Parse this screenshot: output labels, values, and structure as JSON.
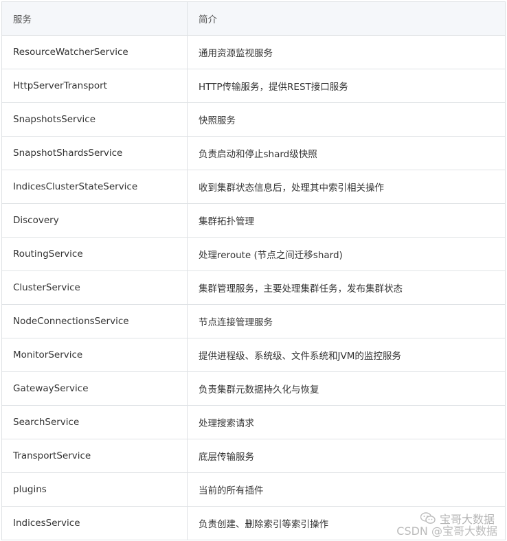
{
  "table": {
    "headers": [
      "服务",
      "简介"
    ],
    "rows": [
      [
        "ResourceWatcherService",
        "通用资源监视服务"
      ],
      [
        "HttpServerTransport",
        "HTTP传输服务，提供REST接口服务"
      ],
      [
        "SnapshotsService",
        "快照服务"
      ],
      [
        "SnapshotShardsService",
        "负责启动和停止shard级快照"
      ],
      [
        "IndicesClusterStateService",
        "收到集群状态信息后，处理其中索引相关操作"
      ],
      [
        "Discovery",
        "集群拓扑管理"
      ],
      [
        "RoutingService",
        "处理reroute (节点之间迁移shard)"
      ],
      [
        "ClusterService",
        "集群管理服务，主要处理集群任务，发布集群状态"
      ],
      [
        "NodeConnectionsService",
        "节点连接管理服务"
      ],
      [
        "MonitorService",
        "提供进程级、系统级、文件系统和JVM的监控服务"
      ],
      [
        "GatewayService",
        "负责集群元数据持久化与恢复"
      ],
      [
        "SearchService",
        "处理搜索请求"
      ],
      [
        "TransportService",
        "底层传输服务"
      ],
      [
        "plugins",
        "当前的所有插件"
      ],
      [
        "IndicesService",
        "负责创建、删除索引等索引操作"
      ]
    ]
  },
  "watermark": {
    "brand_text": "宝哥大数据",
    "csdn_text": "CSDN @宝哥大数据",
    "icon": "wechat-icon"
  }
}
